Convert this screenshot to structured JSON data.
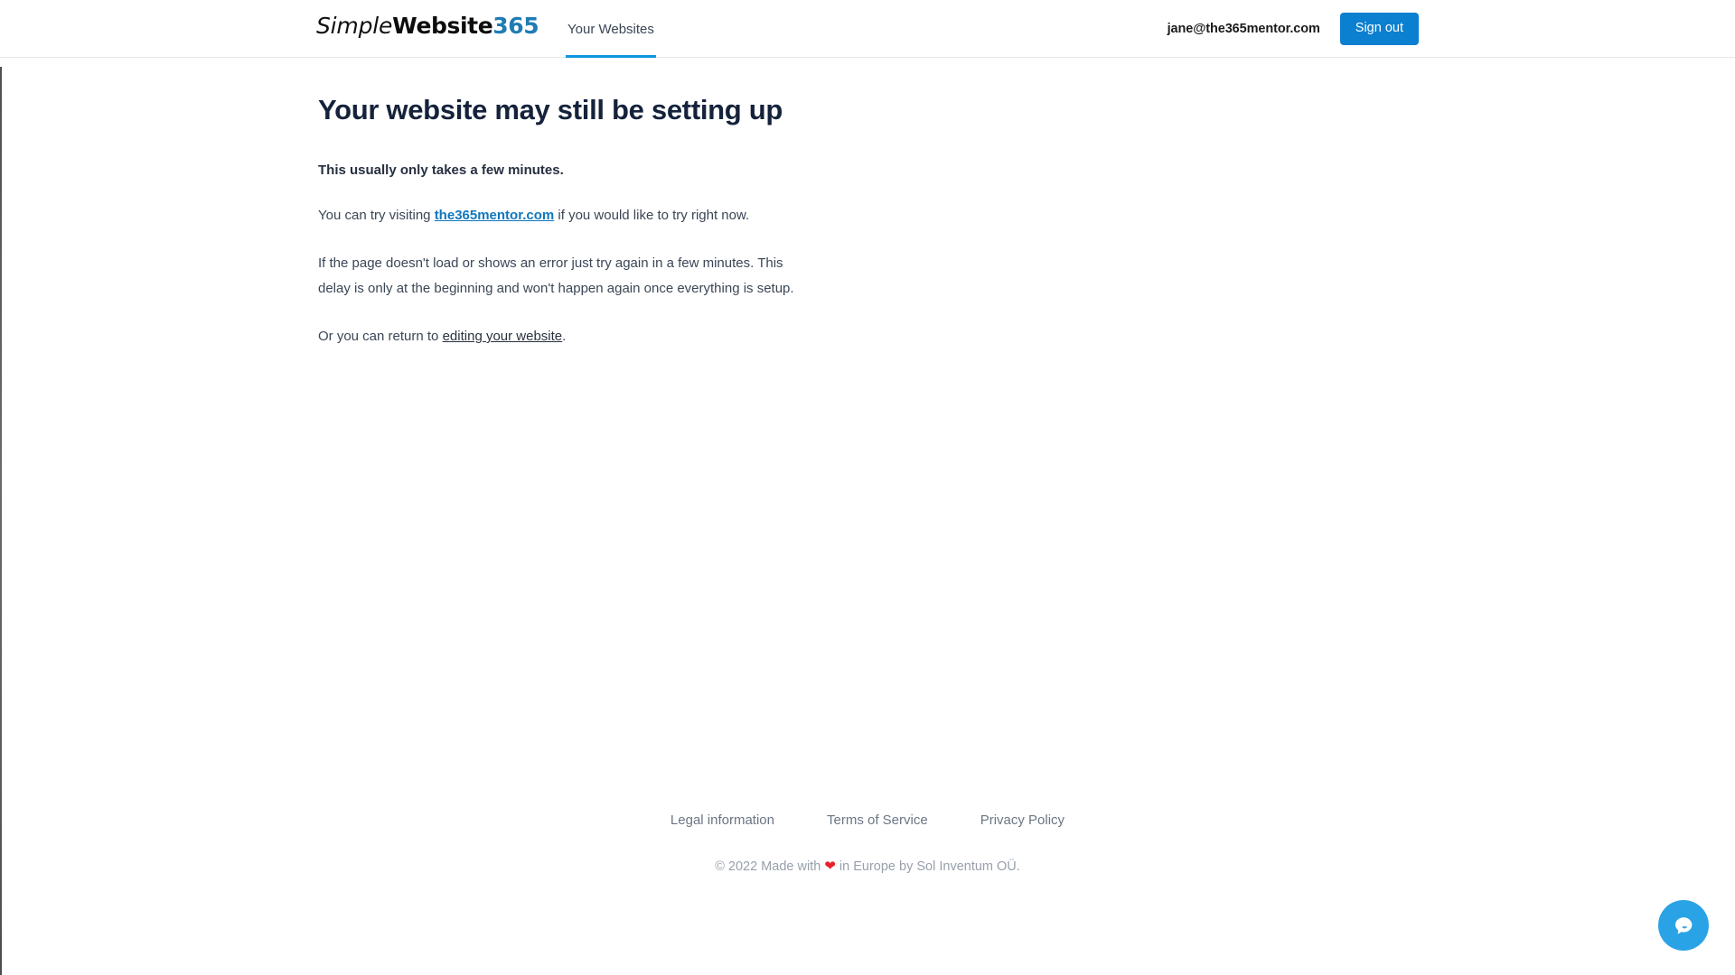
{
  "header": {
    "brand": {
      "part1": "Simple",
      "part2": "Website",
      "part3": "365",
      "accent_color": "#1f7cb4"
    },
    "tabs": [
      {
        "label": "Your Websites",
        "active": true
      }
    ],
    "user_email": "jane@the365mentor.com",
    "signout_label": "Sign out",
    "signout_color": "#0b7fd0"
  },
  "main": {
    "title": "Your website may still be setting up",
    "lead": "This usually only takes a few minutes.",
    "try_line": {
      "before": "You can try visiting ",
      "link": "the365mentor.com",
      "after": " if you would like to try right now."
    },
    "delay_paragraph": "If the page doesn't load or shows an error just try again in a few minutes. This delay is only at the beginning and won't happen again once everything is setup.",
    "return_line": {
      "before": "Or you can return to ",
      "link": "editing your website",
      "after": "."
    }
  },
  "footer": {
    "links": [
      {
        "label": "Legal information"
      },
      {
        "label": "Terms of Service"
      },
      {
        "label": "Privacy Policy"
      }
    ],
    "copyright": {
      "before": "© 2022 Made with ",
      "heart": "❤",
      "after": " in Europe by Sol Inventum OÜ."
    }
  },
  "chat": {
    "icon": "chat-bubble-icon",
    "color": "#2aa3e6"
  }
}
